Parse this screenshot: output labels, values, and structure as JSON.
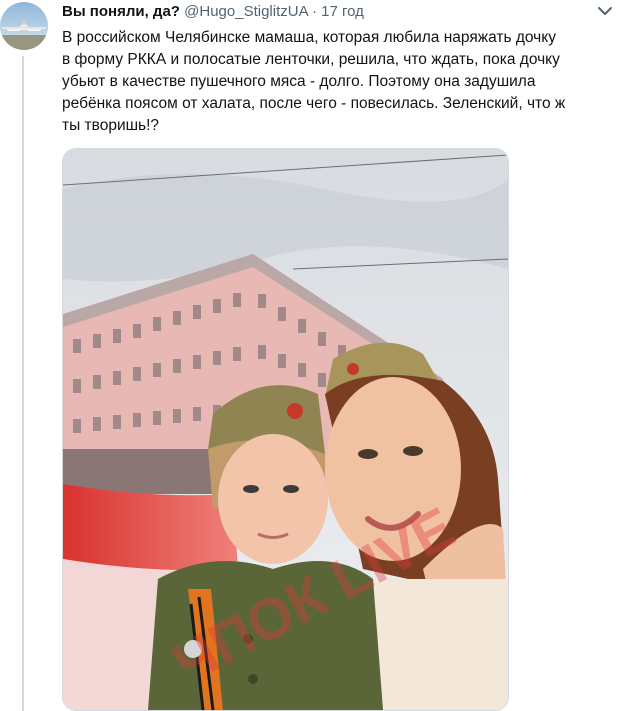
{
  "tweet": {
    "display_name": "Вы поняли, да?",
    "handle": "@Hugo_StiglitzUA",
    "separator": "·",
    "timestamp": "17 год",
    "text": "В российском Челябинске мамаша, которая любила наряжать дочку\nв форму РККА и полосатые ленточки, решила, что ждать, пока дочку\nубьют в качестве пушечного мяса - долго. Поэтому она задушила\nребёнка поясом от халата, после чего - повесилась. Зеленский, что ж\nты творишь!?",
    "media": {
      "watermark": "ЧПОК LIVE"
    }
  },
  "icons": {
    "more": "chevron-down-icon",
    "avatar": "airplane-avatar"
  },
  "colors": {
    "text_primary": "#0f1419",
    "text_secondary": "#536471",
    "border": "#cfd9de",
    "flag_red": "#e03a3a",
    "uniform_green": "#5d6b3a"
  }
}
